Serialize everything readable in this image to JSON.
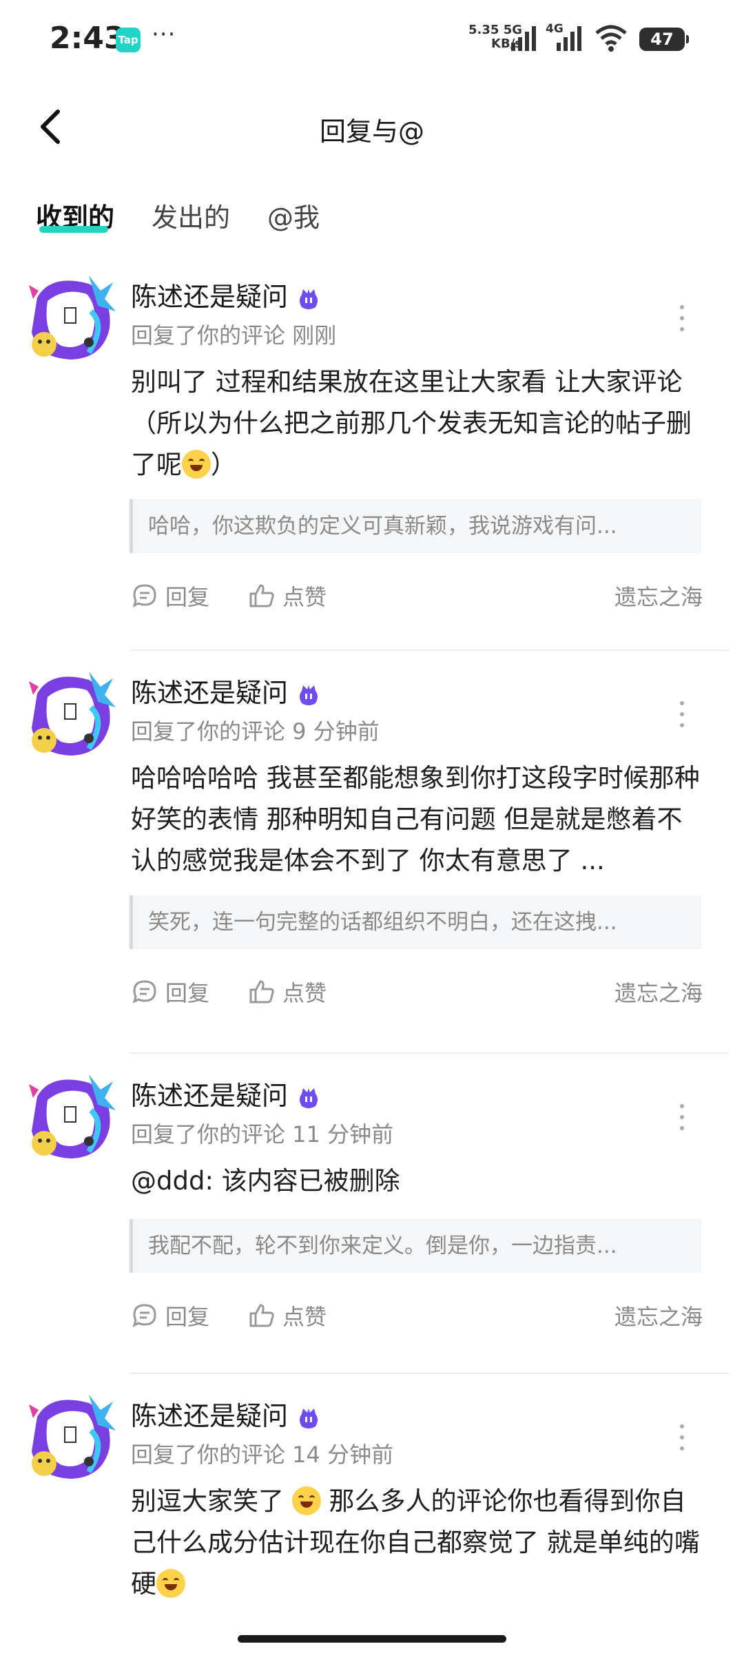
{
  "status_bar": {
    "time": "2:43",
    "app_badge": "Tap",
    "dots": "···",
    "speed_value": "5.35",
    "speed_unit": "KB/s",
    "net1": "5G",
    "net2": "4G",
    "battery": "47"
  },
  "header": {
    "title": "回复与@"
  },
  "tabs": [
    {
      "label": "收到的",
      "active": true
    },
    {
      "label": "发出的",
      "active": false
    },
    {
      "label": "@我",
      "active": false
    }
  ],
  "items": [
    {
      "username": "陈述还是疑问",
      "meta": "回复了你的评论 刚刚",
      "content_a": "别叫了  过程和结果放在这里让大家看  让大家评论（所以为什么把之前那几个发表无知言论的帖子删了呢",
      "content_b": "）",
      "quote": "哈哈，你这欺负的定义可真新颖，我说游戏有问...",
      "reply_label": "回复",
      "like_label": "点赞",
      "board": "遗忘之海"
    },
    {
      "username": "陈述还是疑问",
      "meta": "回复了你的评论 9 分钟前",
      "content_a": "哈哈哈哈哈  我甚至都能想象到你打这段字时候那种好笑的表情  那种明知自己有问题  但是就是憋着不认的感觉我是体会不到了    你太有意思了 ...",
      "quote": "笑死，连一句完整的话都组织不明白，还在这拽...",
      "reply_label": "回复",
      "like_label": "点赞",
      "board": "遗忘之海"
    },
    {
      "username": "陈述还是疑问",
      "meta": "回复了你的评论 11 分钟前",
      "content_a": "@ddd: 该内容已被删除",
      "quote": "我配不配，轮不到你来定义。倒是你，一边指责...",
      "reply_label": "回复",
      "like_label": "点赞",
      "board": "遗忘之海"
    },
    {
      "username": "陈述还是疑问",
      "meta": "回复了你的评论 14 分钟前",
      "content_a": "别逗大家笑了 ",
      "content_b": "  那么多人的评论你也看得到你自己什么成分估计现在你自己都察觉了    就是单纯的嘴硬"
    }
  ],
  "colors": {
    "accent": "#23d3bd",
    "muted": "#8a8a8a",
    "badge": "#6f4cf0"
  }
}
